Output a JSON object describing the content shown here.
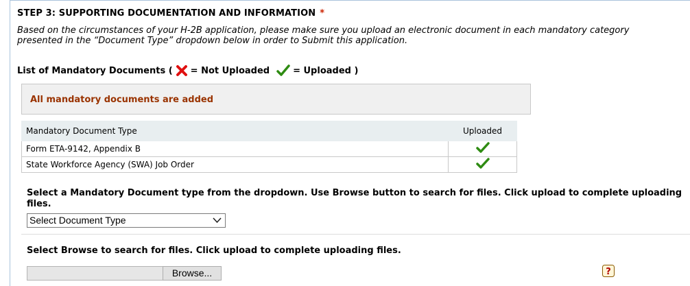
{
  "step": {
    "title": "STEP 3: SUPPORTING DOCUMENTATION AND INFORMATION",
    "required_marker": "*"
  },
  "instructions": "Based on the circumstances of your H-2B application, please make sure you upload an electronic document in each mandatory category presented in the “Document Type” dropdown below in order to Submit this application.",
  "legend": {
    "prefix": "List of Mandatory Documents (",
    "not_uploaded": "= Not Uploaded",
    "uploaded": "= Uploaded )"
  },
  "status_message": "All mandatory documents are added",
  "documents_table": {
    "headers": [
      "Mandatory Document Type",
      "Uploaded"
    ],
    "rows": [
      {
        "type": "Form ETA-9142, Appendix B",
        "uploaded": true
      },
      {
        "type": "State Workforce Agency (SWA) Job Order",
        "uploaded": true
      }
    ]
  },
  "select_section": {
    "label": "Select a Mandatory Document type from the dropdown. Use Browse button to search for files. Click upload to complete uploading files.",
    "selected_value": "Select Document Type"
  },
  "browse_section": {
    "label": "Select Browse to search for files. Click upload to complete uploading files.",
    "button_label": "Browse..."
  },
  "icons": {
    "not_uploaded": "red-x-icon",
    "uploaded": "green-check-icon",
    "help": "help-icon"
  },
  "colors": {
    "required": "#cc2200",
    "status_text": "#9a3300",
    "check": "#2e8b12",
    "cross": "#e01010",
    "help": "#8b5a00"
  }
}
